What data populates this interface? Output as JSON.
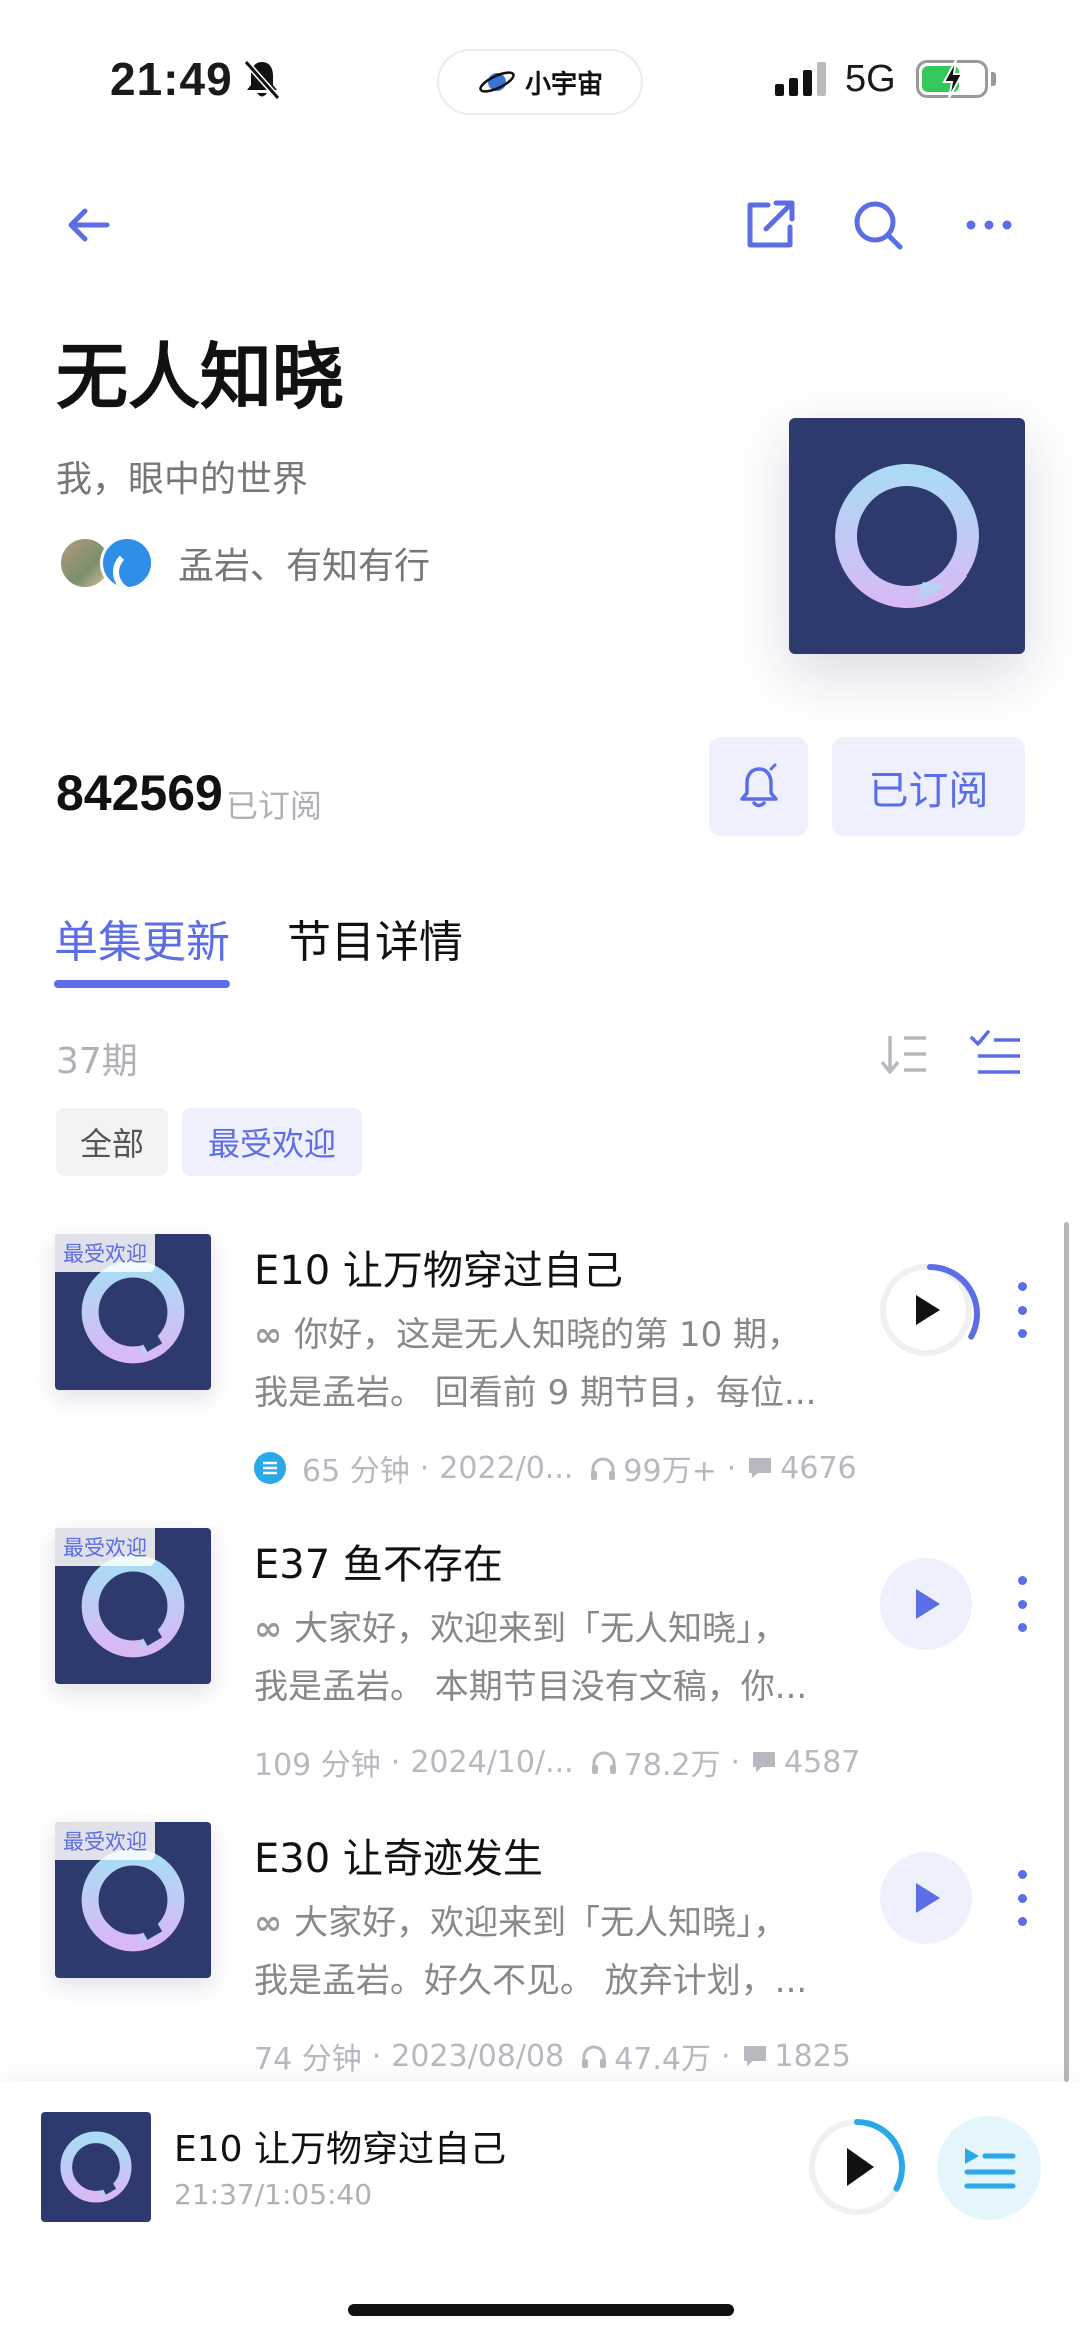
{
  "status_bar": {
    "time": "21:49",
    "pill_label": "小宇宙",
    "network": "5G"
  },
  "header": {
    "back": "back",
    "share": "share",
    "search": "search",
    "more": "more"
  },
  "podcast": {
    "title": "无人知晓",
    "subtitle": "我，眼中的世界",
    "authors": "孟岩、有知有行",
    "subscriber_count": "842569",
    "subscriber_label": "已订阅",
    "subscribed_button": "已订阅"
  },
  "tabs": {
    "episodes": "单集更新",
    "details": "节目详情"
  },
  "list_header": {
    "count": "37期"
  },
  "filters": {
    "all": "全部",
    "popular": "最受欢迎"
  },
  "episodes": [
    {
      "badge": "最受欢迎",
      "title": "E10 让万物穿过自己",
      "desc_line1": "你好，这是无人知晓的第 10 期，",
      "desc_line2": "我是孟岩。 回看前 9 期节目，每位...",
      "duration": "65 分钟",
      "date": "2022/0...",
      "plays": "99万+",
      "comments": "4676",
      "progress": 0.33
    },
    {
      "badge": "最受欢迎",
      "title": "E37 鱼不存在",
      "desc_line1": "大家好，欢迎来到「无人知晓」，",
      "desc_line2": "我是孟岩。 本期节目没有文稿，你...",
      "duration": "109 分钟",
      "date": "2024/10/...",
      "plays": "78.2万",
      "comments": "4587"
    },
    {
      "badge": "最受欢迎",
      "title": "E30 让奇迹发生",
      "desc_line1": "大家好，欢迎来到「无人知晓」，",
      "desc_line2": "我是孟岩。好久不见。 放弃计划，...",
      "duration": "74 分钟",
      "date": "2023/08/08",
      "plays": "47.4万",
      "comments": "1825"
    }
  ],
  "mini_player": {
    "title": "E10 让万物穿过自己",
    "time": "21:37/1:05:40",
    "progress": 0.33
  },
  "colors": {
    "accent": "#5b6ee6",
    "cover_bg": "#2e3a6e",
    "progress_blue": "#2aa8e8"
  }
}
